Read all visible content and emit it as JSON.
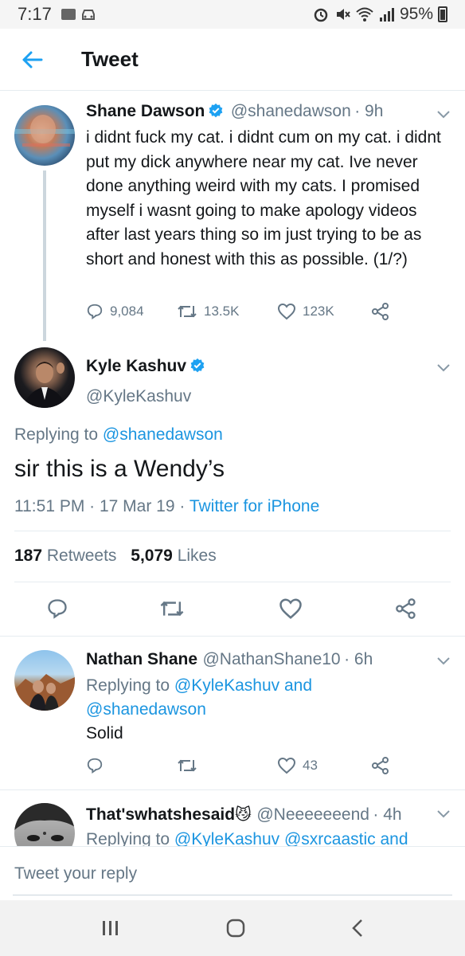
{
  "status_bar": {
    "time": "7:17",
    "battery": "95%"
  },
  "header": {
    "title": "Tweet"
  },
  "thread_tweet": {
    "name": "Shane Dawson",
    "handle": "@shanedawson",
    "time": "· 9h",
    "text": "i didnt fuck my cat. i didnt cum on my cat. i didnt put my dick anywhere near my cat. Ive never done anything weird with my cats. I promised myself i wasnt going to make apology videos after last years thing so im just trying to be as short and honest with this as possible. (1/?)",
    "replies": "9,084",
    "retweets": "13.5K",
    "likes": "123K"
  },
  "main_tweet": {
    "name": "Kyle Kashuv",
    "handle": "@KyleKashuv",
    "replying_prefix": "Replying to",
    "replying_to": "@shanedawson",
    "text": "sir this is a Wendy’s",
    "timestamp": "11:51 PM · 17 Mar 19 ·",
    "source": "Twitter for iPhone",
    "retweet_count": "187",
    "retweet_label": "Retweets",
    "like_count": "5,079",
    "like_label": "Likes"
  },
  "reply1": {
    "name": "Nathan Shane",
    "handle": "@NathanShane10",
    "time": "· 6h",
    "replying_prefix": "Replying to",
    "replying_to": "@KyleKashuv",
    "and": "and",
    "replying_to2": "@shanedawson",
    "text": "Solid",
    "likes": "43"
  },
  "reply2": {
    "name": "That'swhatshesaid",
    "emoji": "😼",
    "handle": "@Neeeeeeend",
    "time": "· 4h",
    "replying_prefix": "Replying to",
    "replying_to": "@KyleKashuv",
    "replying_to2": "@sxrcaastic",
    "and": "and"
  },
  "reply_bar": {
    "placeholder": "Tweet your reply"
  },
  "colors": {
    "accent": "#1da1f2",
    "link": "#1b95e0",
    "text": "#14171a",
    "muted": "#657786"
  }
}
